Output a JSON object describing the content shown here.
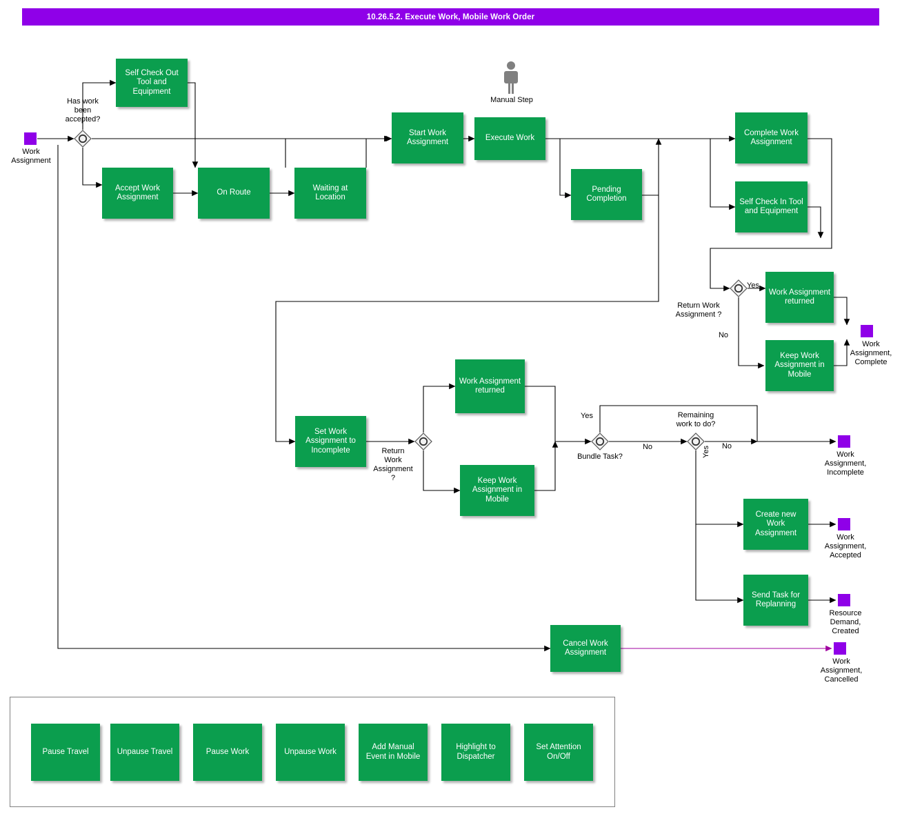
{
  "header": {
    "title": "10.26.5.2. Execute Work, Mobile Work Order",
    "accent_color": "#8f00e8"
  },
  "colors": {
    "task_fill": "#0b9e4e",
    "task_text": "#ffffff",
    "event_fill": "#8f00e8",
    "edge": "#000000",
    "cancel_edge": "#a000a0",
    "gateway_fill": "#f2f2f2",
    "gateway_stroke": "#555555"
  },
  "diagram": {
    "start_events": [
      {
        "name": "work-assignment-start",
        "label": "Work\nAssignment"
      }
    ],
    "end_events": [
      {
        "name": "work-assignment-complete-end",
        "label": "Work\nAssignment,\nComplete"
      },
      {
        "name": "work-assignment-incomplete-end",
        "label": "Work\nAssignment,\nIncomplete"
      },
      {
        "name": "work-assignment-accepted-end",
        "label": "Work\nAssignment,\nAccepted"
      },
      {
        "name": "resource-demand-created-end",
        "label": "Resource\nDemand,\nCreated"
      },
      {
        "name": "work-assignment-cancelled-end",
        "label": "Work\nAssignment,\nCancelled"
      }
    ],
    "gateways": [
      {
        "name": "gateway-has-work-been-accepted",
        "label": "Has work\nbeen\naccepted?"
      },
      {
        "name": "gateway-return-work-assignment-1",
        "label": "Return Work\nAssignment ?"
      },
      {
        "name": "gateway-return-work-assignment-2",
        "label": "Return\nWork\nAssignment\n?"
      },
      {
        "name": "gateway-bundle-task",
        "label": "Bundle Task?"
      },
      {
        "name": "gateway-remaining-work-to-do",
        "label": "Remaining\nwork to do?"
      }
    ],
    "edge_labels": [
      {
        "name": "edge-label-yes-return-1",
        "label": "Yes"
      },
      {
        "name": "edge-label-no-return-1",
        "label": "No"
      },
      {
        "name": "edge-label-yes-bundle",
        "label": "Yes"
      },
      {
        "name": "edge-label-no-bundle",
        "label": "No"
      },
      {
        "name": "edge-label-no-remaining",
        "label": "No"
      },
      {
        "name": "edge-label-yes-remaining",
        "label": "Yes"
      }
    ],
    "annotations": [
      {
        "name": "manual-step-annotation",
        "label": "Manual Step"
      }
    ],
    "tasks": [
      {
        "name": "task-self-check-out-tool-and-equipment",
        "label": "Self Check Out\nTool and\nEquipment"
      },
      {
        "name": "task-accept-work-assignment",
        "label": "Accept Work\nAssignment"
      },
      {
        "name": "task-on-route",
        "label": "On Route"
      },
      {
        "name": "task-waiting-at-location",
        "label": "Waiting at\nLocation"
      },
      {
        "name": "task-start-work-assignment",
        "label": "Start Work\nAssignment"
      },
      {
        "name": "task-execute-work",
        "label": "Execute Work"
      },
      {
        "name": "task-pending-completion",
        "label": "Pending\nCompletion"
      },
      {
        "name": "task-complete-work-assignment",
        "label": "Complete Work\nAssignment"
      },
      {
        "name": "task-self-check-in-tool-and-equipment",
        "label": "Self Check In\nTool and\nEquipment"
      },
      {
        "name": "task-work-assignment-returned-1",
        "label": "Work\nAssignment\nreturned"
      },
      {
        "name": "task-keep-work-assignment-in-mobile-1",
        "label": "Keep Work\nAssignment in\nMobile"
      },
      {
        "name": "task-set-work-assignment-to-incomplete",
        "label": "Set Work\nAssignment to\nIncomplete"
      },
      {
        "name": "task-work-assignment-returned-2",
        "label": "Work\nAssignment\nreturned"
      },
      {
        "name": "task-keep-work-assignment-in-mobile-2",
        "label": "Keep Work\nAssignment in\nMobile"
      },
      {
        "name": "task-create-new-work-assignment",
        "label": "Create new\nWork\nAssignment"
      },
      {
        "name": "task-send-task-for-replanning",
        "label": "Send Task for\nReplanning"
      },
      {
        "name": "task-cancel-work-assignment",
        "label": "Cancel Work\nAssignment"
      }
    ],
    "legend_tasks": [
      {
        "name": "legend-task-pause-travel",
        "label": "Pause Travel"
      },
      {
        "name": "legend-task-unpause-travel",
        "label": "Unpause Travel"
      },
      {
        "name": "legend-task-pause-work",
        "label": "Pause Work"
      },
      {
        "name": "legend-task-unpause-work",
        "label": "Unpause Work"
      },
      {
        "name": "legend-task-add-manual-event-in-mobile",
        "label": "Add Manual\nEvent in Mobile"
      },
      {
        "name": "legend-task-highlight-to-dispatcher",
        "label": "Highlight to\nDispatcher"
      },
      {
        "name": "legend-task-set-attention-on-off",
        "label": "Set Attention\nOn/Off"
      }
    ]
  }
}
